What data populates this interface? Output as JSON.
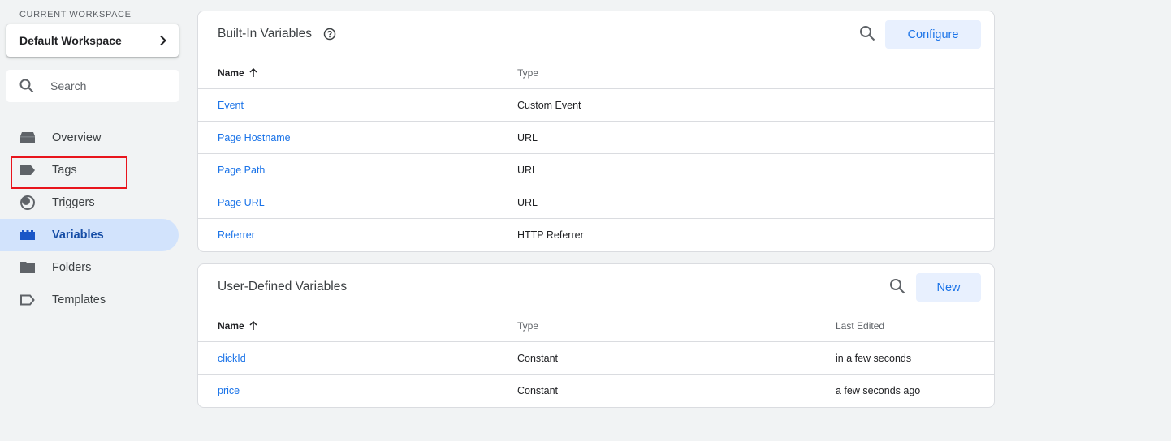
{
  "sidebar": {
    "workspace_label": "CURRENT WORKSPACE",
    "workspace_name": "Default Workspace",
    "search_placeholder": "Search",
    "nav": [
      {
        "label": "Overview",
        "icon": "overview-icon"
      },
      {
        "label": "Tags",
        "icon": "tag-icon"
      },
      {
        "label": "Triggers",
        "icon": "trigger-icon"
      },
      {
        "label": "Variables",
        "icon": "variables-icon",
        "active": true
      },
      {
        "label": "Folders",
        "icon": "folder-icon"
      },
      {
        "label": "Templates",
        "icon": "template-icon"
      }
    ]
  },
  "builtin": {
    "title": "Built-In Variables",
    "configure_label": "Configure",
    "columns": [
      "Name",
      "Type"
    ],
    "rows": [
      {
        "name": "Event",
        "type": "Custom Event"
      },
      {
        "name": "Page Hostname",
        "type": "URL"
      },
      {
        "name": "Page Path",
        "type": "URL"
      },
      {
        "name": "Page URL",
        "type": "URL"
      },
      {
        "name": "Referrer",
        "type": "HTTP Referrer"
      }
    ]
  },
  "user_defined": {
    "title": "User-Defined Variables",
    "new_label": "New",
    "columns": [
      "Name",
      "Type",
      "Last Edited"
    ],
    "rows": [
      {
        "name": "clickId",
        "type": "Constant",
        "edited": "in a few seconds"
      },
      {
        "name": "price",
        "type": "Constant",
        "edited": "a few seconds ago"
      }
    ]
  },
  "colors": {
    "accent": "#1a73e8",
    "active_bg": "#d2e3fc",
    "highlight": "#e8141c",
    "page_bg": "#f1f3f4"
  }
}
